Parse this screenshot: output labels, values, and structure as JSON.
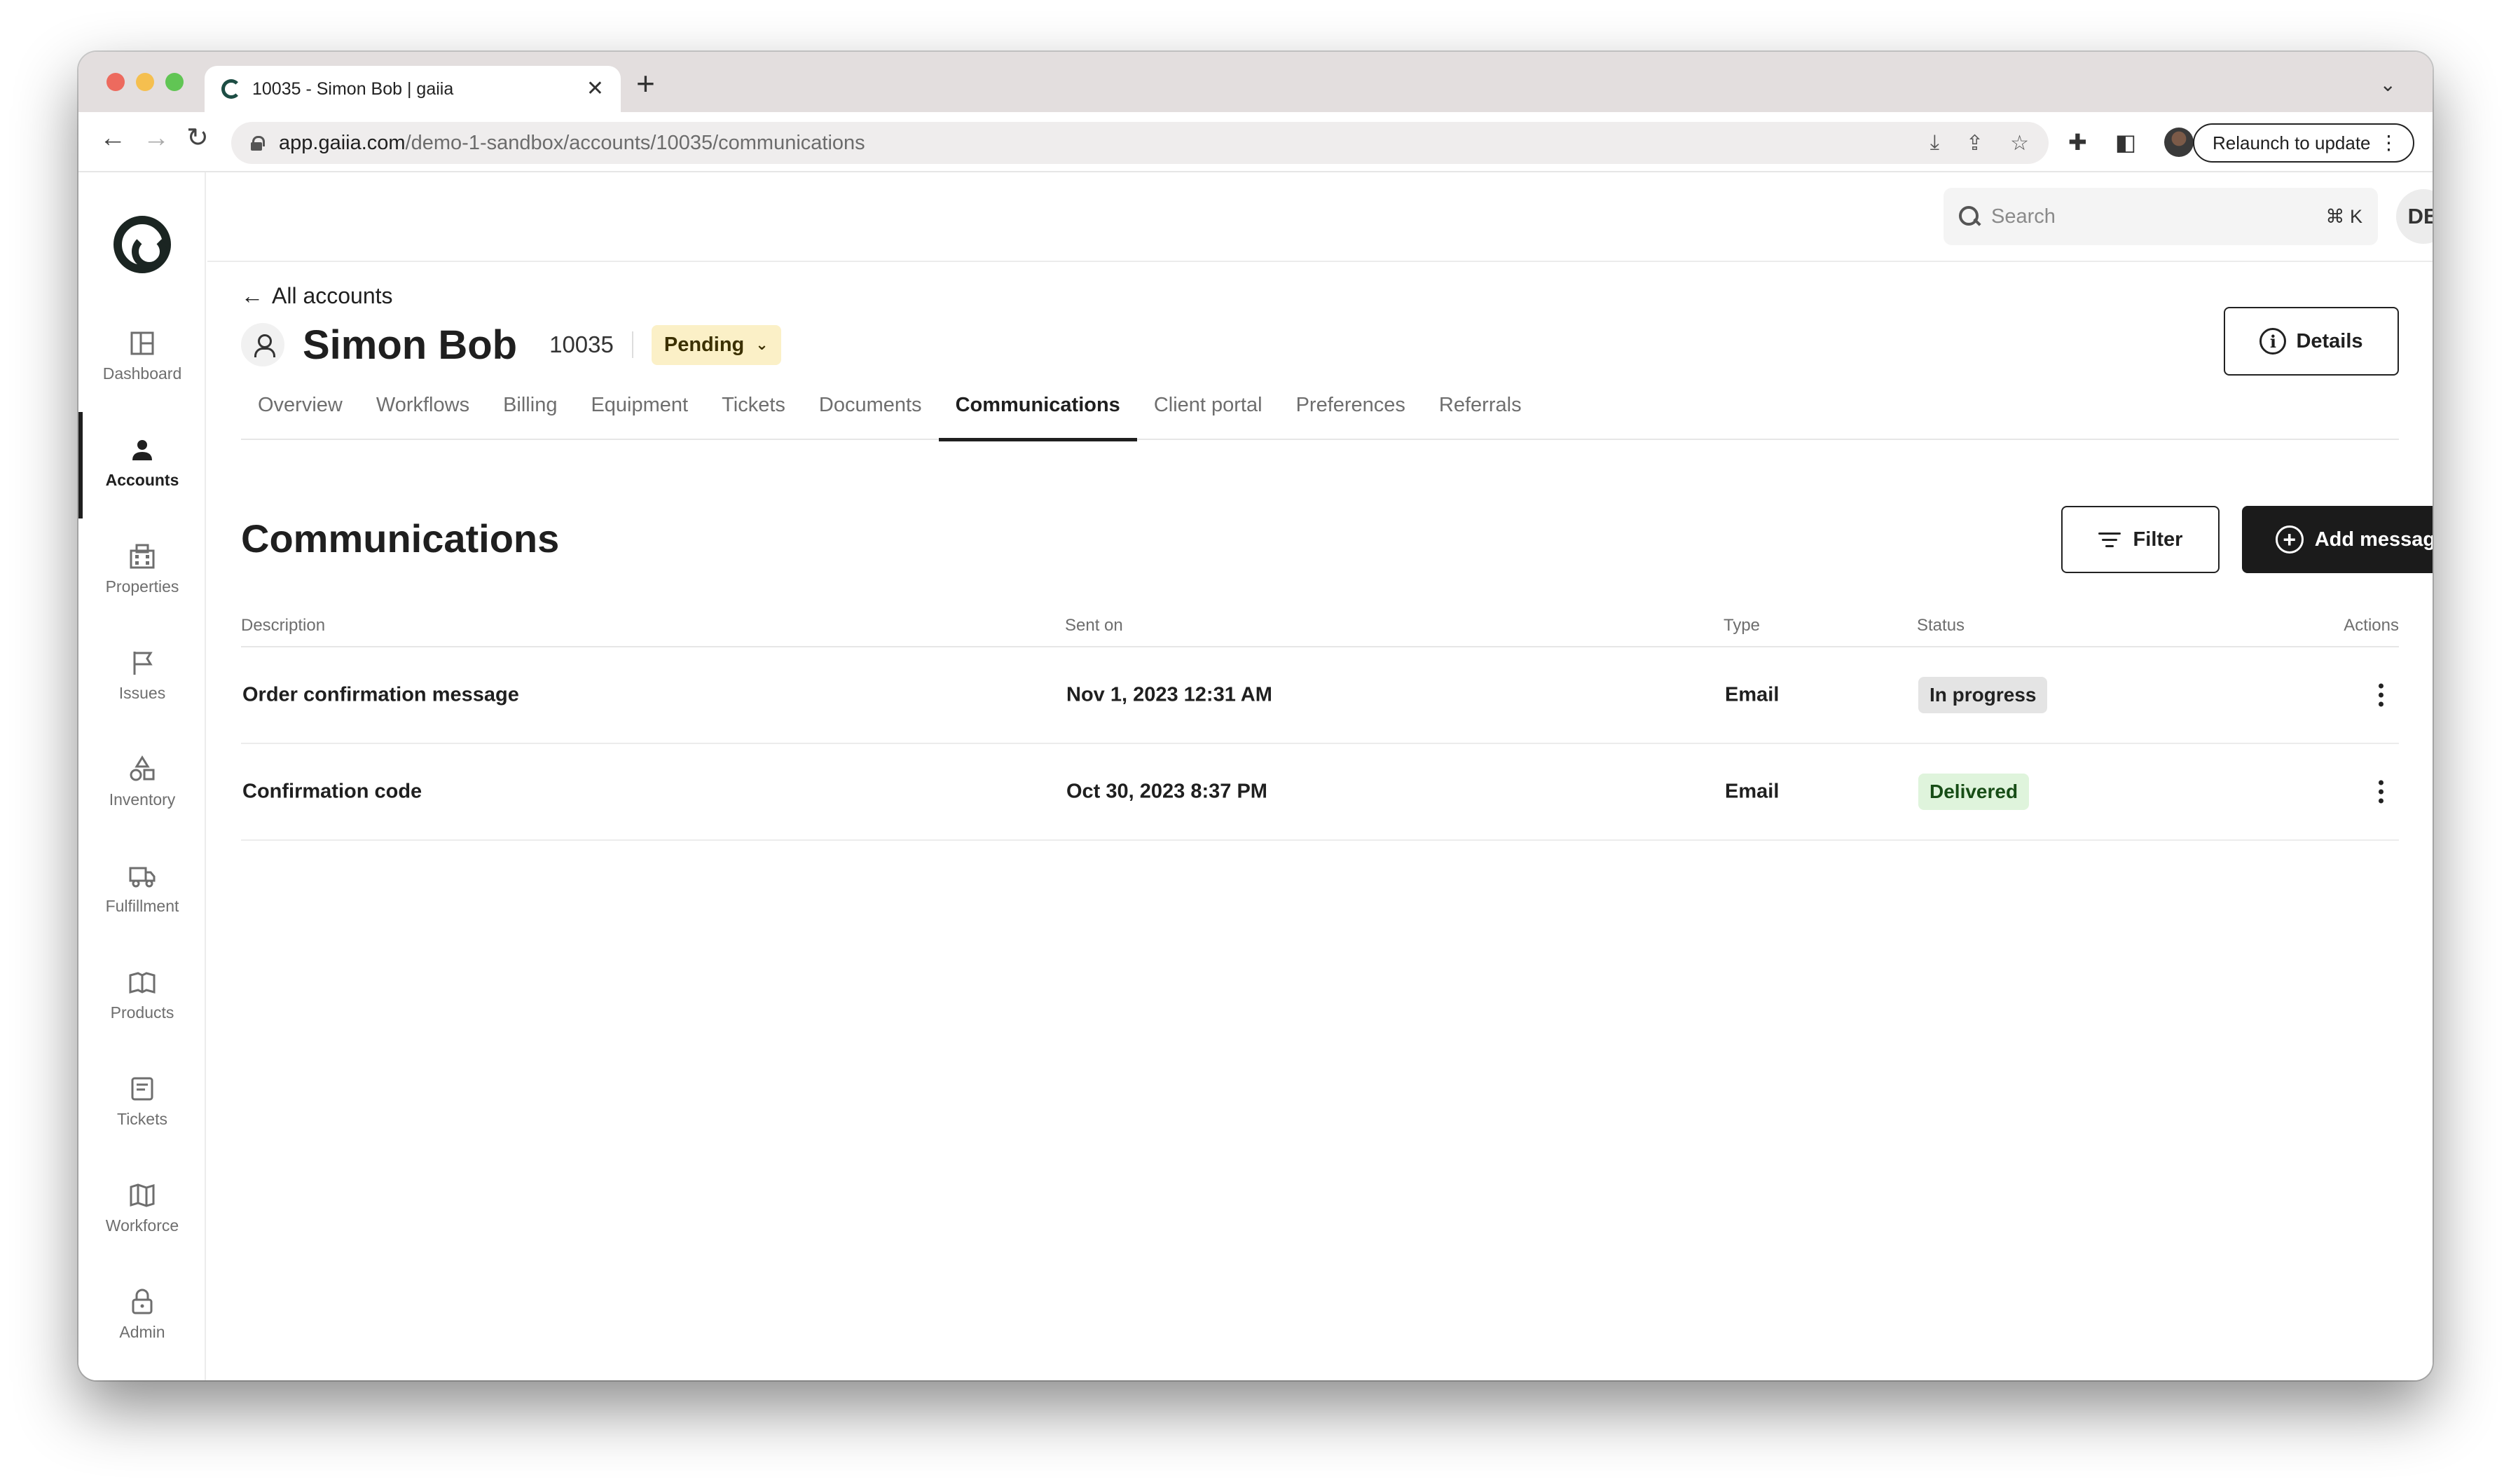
{
  "browser": {
    "tab_title": "10035 - Simon Bob | gaiia",
    "new_tab": "+",
    "url_host": "app.gaiia.com",
    "url_path": "/demo-1-sandbox/accounts/10035/communications",
    "relaunch_label": "Relaunch to update"
  },
  "sidebar": {
    "items": [
      {
        "label": "Dashboard",
        "icon": "dashboard-icon"
      },
      {
        "label": "Accounts",
        "icon": "user-icon"
      },
      {
        "label": "Properties",
        "icon": "building-icon"
      },
      {
        "label": "Issues",
        "icon": "flag-icon"
      },
      {
        "label": "Inventory",
        "icon": "shapes-icon"
      },
      {
        "label": "Fulfillment",
        "icon": "truck-icon"
      },
      {
        "label": "Products",
        "icon": "book-icon"
      },
      {
        "label": "Tickets",
        "icon": "ticket-icon"
      },
      {
        "label": "Workforce",
        "icon": "map-icon"
      },
      {
        "label": "Admin",
        "icon": "lock-icon"
      }
    ]
  },
  "header": {
    "search_placeholder": "Search",
    "search_shortcut": "⌘ K",
    "avatar_initials": "DB"
  },
  "account": {
    "back_label": "All accounts",
    "name": "Simon Bob",
    "id": "10035",
    "status": "Pending",
    "details_label": "Details"
  },
  "tabs": [
    "Overview",
    "Workflows",
    "Billing",
    "Equipment",
    "Tickets",
    "Documents",
    "Communications",
    "Client portal",
    "Preferences",
    "Referrals"
  ],
  "section": {
    "title": "Communications",
    "filter_label": "Filter",
    "add_label": "Add message"
  },
  "table": {
    "columns": [
      "Description",
      "Sent on",
      "Type",
      "Status",
      "Actions"
    ],
    "rows": [
      {
        "description": "Order confirmation message",
        "sent_on": "Nov 1, 2023 12:31 AM",
        "type": "Email",
        "status": "In progress"
      },
      {
        "description": "Confirmation code",
        "sent_on": "Oct 30, 2023 8:37 PM",
        "type": "Email",
        "status": "Delivered"
      }
    ]
  },
  "colors": {
    "primary": "#1b1b1b",
    "pending_bg": "#fbf0c7",
    "in_progress_bg": "#e4e4e4",
    "delivered_bg": "#dff4dc"
  }
}
